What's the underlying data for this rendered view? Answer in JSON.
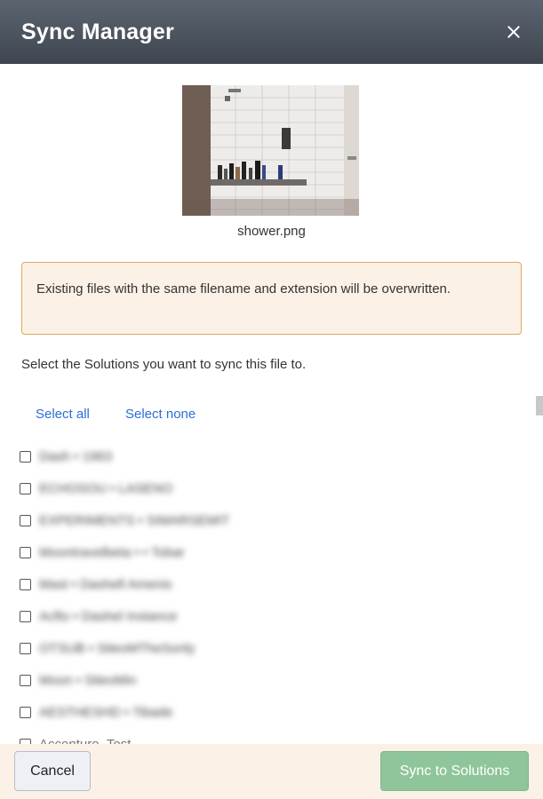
{
  "header": {
    "title": "Sync Manager",
    "close_icon": "close-icon"
  },
  "file": {
    "name": "shower.png"
  },
  "warning": {
    "text": "Existing files with the same filename and extension will be overwritten."
  },
  "instructions": "Select the Solutions you want to sync this file to.",
  "actions": {
    "select_all": "Select all",
    "select_none": "Select none"
  },
  "solutions": [
    {
      "label": "Dash • 1963",
      "checked": false
    },
    {
      "label": "ECHOSOU • LASENO",
      "checked": false
    },
    {
      "label": "EXPERIMENTS • SIMARSEMIT",
      "checked": false
    },
    {
      "label": "Moontravelbeta • • Tobar",
      "checked": false
    },
    {
      "label": "Mast • Dashell Amenis",
      "checked": false
    },
    {
      "label": "Acfto • Dashel Instance",
      "checked": false
    },
    {
      "label": "OTSUB • SiteoMTheSonly",
      "checked": false
    },
    {
      "label": "Moon • SiteoMin",
      "checked": false
    },
    {
      "label": "AESTHESHD • Tibade",
      "checked": false
    },
    {
      "label": "Accenture_Test",
      "checked": false
    }
  ],
  "footer": {
    "cancel_label": "Cancel",
    "sync_label": "Sync to Solutions"
  },
  "colors": {
    "header_bg": "#4a525c",
    "link": "#2b6fd6",
    "warning_bg": "#fbf1e6",
    "warning_border": "#e0a860",
    "sync_button_disabled": "#8fc59a"
  }
}
